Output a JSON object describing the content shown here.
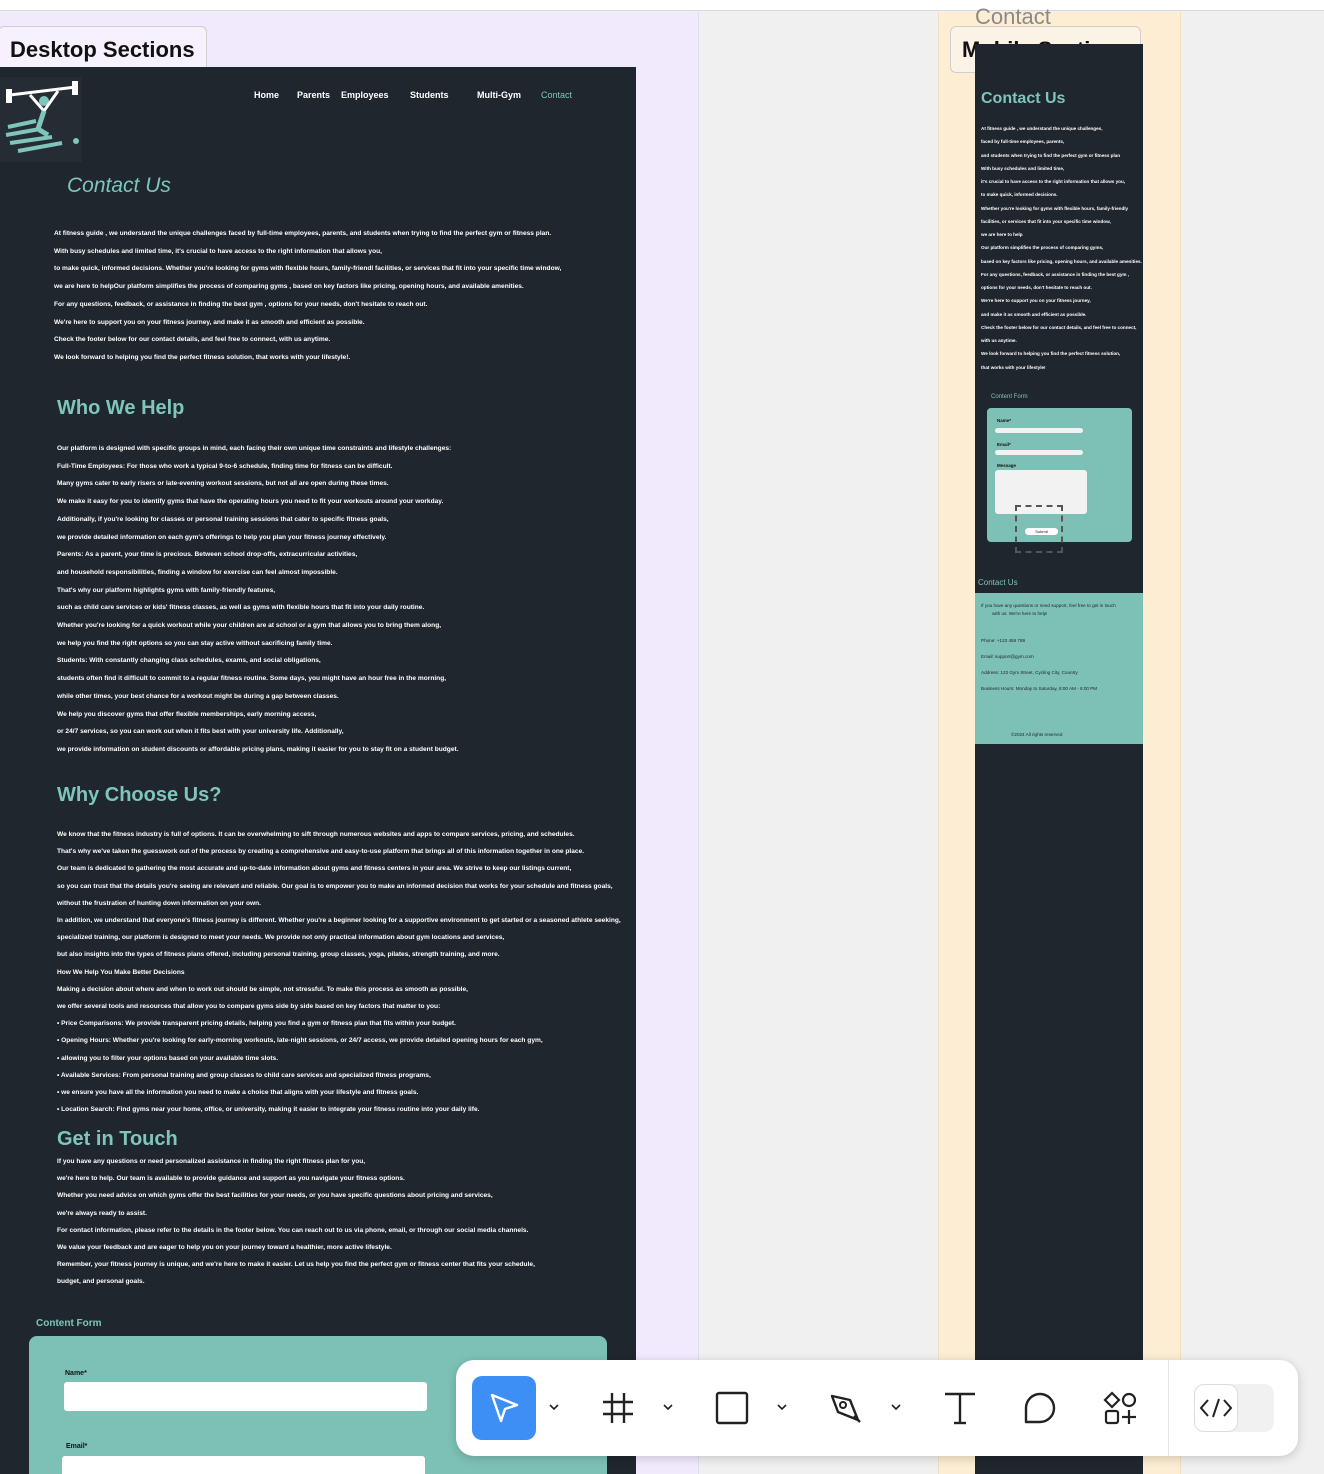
{
  "canvas": {
    "ghost_title": "Contact",
    "desktop_label": "Desktop Sections",
    "mobile_label": "Mobile Sections"
  },
  "desktop": {
    "nav": [
      "Home",
      "Parents",
      "Employees",
      "Students",
      "Multi-Gym",
      "Contact"
    ],
    "contact_title": "Contact Us",
    "contact_lines": [
      "At fitness guide , we understand the unique challenges faced by full-time employees, parents, and students when trying to find the perfect gym or fitness plan.",
      "With busy schedules and limited time, it's crucial to have access to the right information that allows you,",
      " to make quick, informed decisions. Whether you're looking for gyms with flexible hours, family-friendl facilities, or services that fit into your specific time window,",
      " we are here to helpOur platform simplifies the process of comparing gyms , based on key factors like pricing, opening hours, and available amenities.",
      "For any questions, feedback, or assistance in finding the best gym , options for your needs, don't hesitate to reach out.",
      "We're here to support you on your fitness journey,  and make it as smooth and efficient as possible.",
      "Check the footer below for our contact details, and feel free to connect, with us anytime.",
      "We look forward to helping you find the perfect fitness solution, that works with your lifestyle!."
    ],
    "who_title": "Who We Help",
    "who_lines": [
      "Our platform is designed with specific groups in mind, each facing their own unique time constraints and lifestyle challenges:",
      "Full-Time Employees: For those who work a typical 9-to-6 schedule, finding time for fitness can be difficult.",
      "Many gyms cater to early risers or late-evening workout sessions, but not all are open during these times.",
      "We make it easy for you to identify gyms that have the operating hours you need to fit your workouts around your workday.",
      "Additionally, if you're looking for classes or personal training sessions that cater to specific fitness goals,",
      "we provide detailed information on each gym's offerings to help you plan your fitness journey effectively.",
      "Parents: As a parent, your time is precious. Between school drop-offs, extracurricular activities,",
      "and household responsibilities, finding a window for exercise can feel almost impossible.",
      "That's why our platform highlights gyms with family-friendly features,",
      "such as child care services or kids' fitness classes, as well as gyms with flexible hours that fit into your daily routine.",
      "Whether you're looking for a quick workout while your children are at school or a gym that allows you to bring them along,",
      "we help you find the right options so you can stay active without sacrificing family time.",
      "Students: With constantly changing class schedules, exams, and social obligations,",
      "students often find it difficult to commit to a regular fitness routine. Some days, you might have an hour free in the morning,",
      "while other times, your best chance for a workout might be during a gap between classes.",
      "We help you discover gyms that offer flexible memberships, early morning access,",
      "or 24/7 services, so you can work out when it fits best with your university life. Additionally,",
      "we provide information on student discounts or affordable pricing plans, making it easier for you to stay fit on a student budget."
    ],
    "why_title": "Why Choose Us?",
    "why_lines": [
      "We know that the fitness industry is full of options. It can be overwhelming to sift through numerous websites and apps to compare services, pricing, and schedules.",
      " That's why we've taken the guesswork out of the process by creating a comprehensive and easy-to-use platform that brings all of this information together in one place.",
      "Our team is dedicated to gathering the most accurate and up-to-date information about gyms and fitness centers in your area. We strive to keep our listings current,",
      "so you can trust that the details you're seeing are relevant and reliable. Our goal is to empower you to make an informed decision that works for your schedule and fitness goals,",
      " without the frustration of hunting down information on your own.",
      "In addition, we understand that everyone's fitness journey is different. Whether you're a beginner looking for a supportive environment to get started or a seasoned athlete seeking,",
      " specialized training, our platform is designed to meet your needs. We provide not only practical information about gym locations and services,",
      " but also insights into the types of fitness plans offered, including personal training, group classes, yoga, pilates, strength training, and more.",
      "How We Help You Make Better Decisions",
      "Making a decision about where and when to work out should be simple, not stressful. To make this process as smooth as possible,",
      " we offer several tools and resources that allow you to compare gyms side by side based on key factors that matter to you:",
      "  •  Price Comparisons: We provide transparent pricing details, helping you find a gym or fitness plan that fits within your budget.",
      "  •  Opening Hours: Whether you're looking for early-morning workouts, late-night sessions, or 24/7 access, we provide detailed opening hours for each gym,",
      "  •  allowing you to filter your options based on your available time slots.",
      "  •  Available Services: From personal training and group classes to child care services and specialized fitness programs,",
      "  •  we ensure you have all the information you need to make a choice that aligns with your lifestyle and fitness goals.",
      "  •  Location Search: Find gyms near your home, office, or university, making it easier to integrate your fitness routine into your daily life."
    ],
    "touch_title": "Get in Touch",
    "touch_lines": [
      "If you have any questions or need personalized assistance in finding the right fitness plan for you,",
      " we're here to help. Our team is available to provide guidance and support as you navigate your fitness options.",
      " Whether you need advice on which gyms offer the best facilities for your needs, or you have specific questions about pricing and services,",
      " we're always ready to assist.",
      "For contact information, please refer to the details in the footer below. You can reach out to us via phone, email, or through our social media channels.",
      "We value your feedback and are eager to help you on your journey toward a healthier, more active lifestyle.",
      "Remember, your fitness journey is unique, and we're here to make it easier. Let us help you find the perfect gym or fitness center that fits your schedule,",
      "budget, and personal goals."
    ],
    "form_title": "Content Form",
    "form_name_label": "Name*",
    "form_email_label": "Email*"
  },
  "mobile": {
    "contact_title": "Contact Us",
    "lines": [
      "At fitness guide , we understand the unique challenges,",
      " faced by full-time employees, parents,",
      "and students when trying to find the perfect gym or fitness plan",
      " With busy schedules and limited time,",
      "it's crucial to have access to the right information that allows you,",
      " to make quick, informed decisions.",
      "Whether you're looking for gyms with flexible hours, family-friendly",
      " facilities, or services that fit into your specific time window,",
      " we are here to help",
      "Our platform simplifies the process of comparing gyms,",
      " based on key factors like pricing, opening hours, and available amenities.",
      "For any questions, feedback, or assistance in finding the best gym ,",
      "options for your needs, don't hesitate to reach out.",
      "We're here to support you on your fitness journey,",
      " and make it as smooth and efficient as possible.",
      "Check the footer below for our contact details, and feel free to connect,",
      " with us anytime.",
      "We look forward to helping you find the perfect fitness solution,",
      " that works with your lifestyle!"
    ],
    "form_title": "Content Form",
    "form_name_label": "Name*",
    "form_email_label": "Email*",
    "form_message_label": "Message",
    "form_submit": "Submit",
    "footer_title": "Contact Us",
    "footer_intro_1": "If you have any questions or need support, feel free to get in touch",
    "footer_intro_2": "with us. We're here to help!",
    "phone": "Phone: +123 456 789",
    "email": "Email: support@gym.com",
    "address": "Address: 123 Gym Street, Cycling City, Country",
    "hours": "Business Hours: Monday to Saturday, 8:00 AM - 6:00 PM",
    "copyright": "©2024 All rights reserved"
  },
  "toolbar": {
    "tools": [
      "move-tool",
      "frame-tool",
      "shape-tool",
      "pen-tool",
      "text-tool",
      "comment-tool",
      "actions-tool",
      "dev-mode-toggle"
    ],
    "accent": "#3d8ff5"
  },
  "colors": {
    "frame_bg": "#20262d",
    "accent_teal": "#7ec5bb",
    "form_bg": "#7dc1b6",
    "desktop_section_bg": "#f1eafd",
    "mobile_section_bg": "#fcedd3"
  }
}
